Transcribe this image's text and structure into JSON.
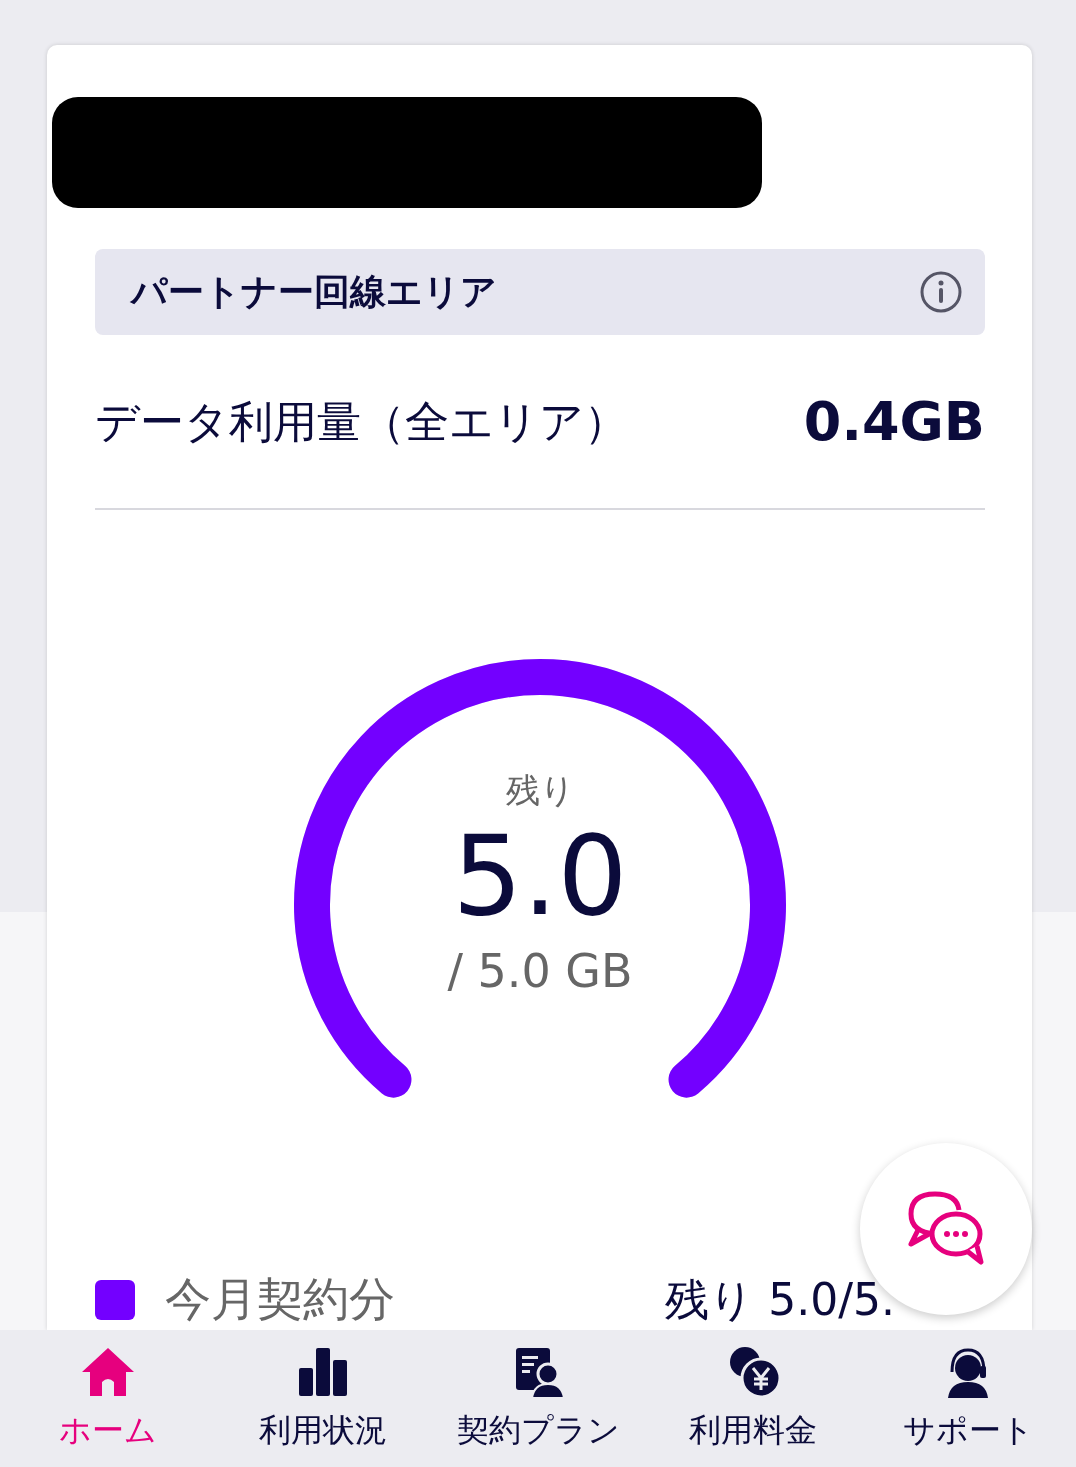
{
  "area_header": {
    "title": "パートナー回線エリア"
  },
  "usage": {
    "label": "データ利用量（全エリア）",
    "value": "0.4GB"
  },
  "gauge": {
    "caption": "残り",
    "remaining": "5.0",
    "total": "/ 5.0 GB",
    "level": 1.0
  },
  "legend": [
    {
      "label": "今月契約分",
      "reading": "残り 5.0/5.",
      "color": "#7300ff"
    }
  ],
  "bottom_nav": [
    {
      "label": "ホーム",
      "selected": true
    },
    {
      "label": "利用状況",
      "selected": false
    },
    {
      "label": "契約プラン",
      "selected": false
    },
    {
      "label": "利用料金",
      "selected": false
    },
    {
      "label": "サポート",
      "selected": false
    }
  ]
}
